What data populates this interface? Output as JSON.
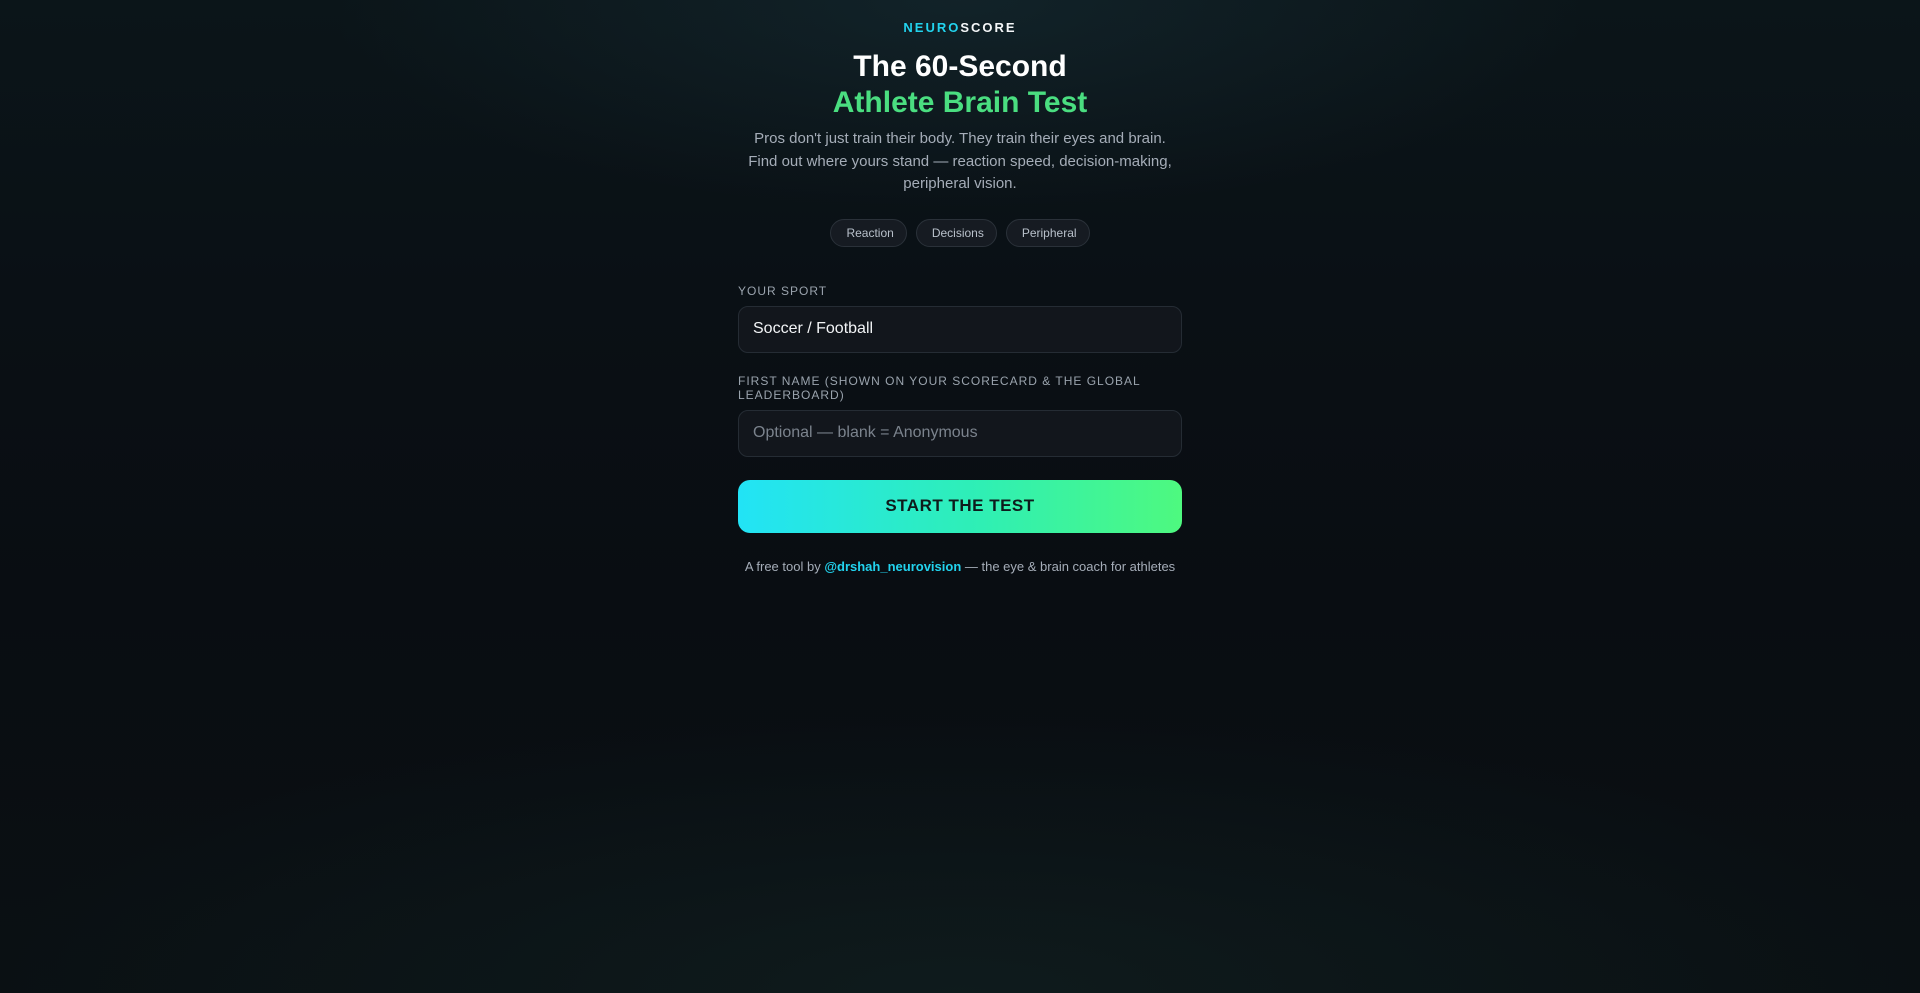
{
  "brand": {
    "part1": "NEURO",
    "part2": "SCORE",
    "accent_color": "#22d3ee"
  },
  "hero": {
    "title_line1": "The 60-Second",
    "title_line2": "Athlete Brain Test",
    "title_accent_color": "#4ade80",
    "subtitle": "Pros don't just train their body. They train their eyes and brain. Find out where yours stand — reaction speed, decision-making, peripheral vision."
  },
  "chips": [
    {
      "icon": "lightning-icon",
      "glyph": "",
      "label": "Reaction"
    },
    {
      "icon": "brain-icon",
      "glyph": "",
      "label": "Decisions"
    },
    {
      "icon": "eye-icon",
      "glyph": "",
      "label": "Peripheral"
    }
  ],
  "form": {
    "sport_label": "Your Sport",
    "sport_value": "Soccer / Football",
    "name_label": "First name (shown on your scorecard & the global leaderboard)",
    "name_value": "",
    "name_placeholder": "Optional — blank = Anonymous",
    "submit_label": "START THE TEST",
    "button_gradient": [
      "#22e3f6",
      "#4ef97f"
    ]
  },
  "footer": {
    "prefix": "A free tool by",
    "handle": "@drshah_neurovision",
    "suffix": "— the eye & brain coach for athletes"
  }
}
